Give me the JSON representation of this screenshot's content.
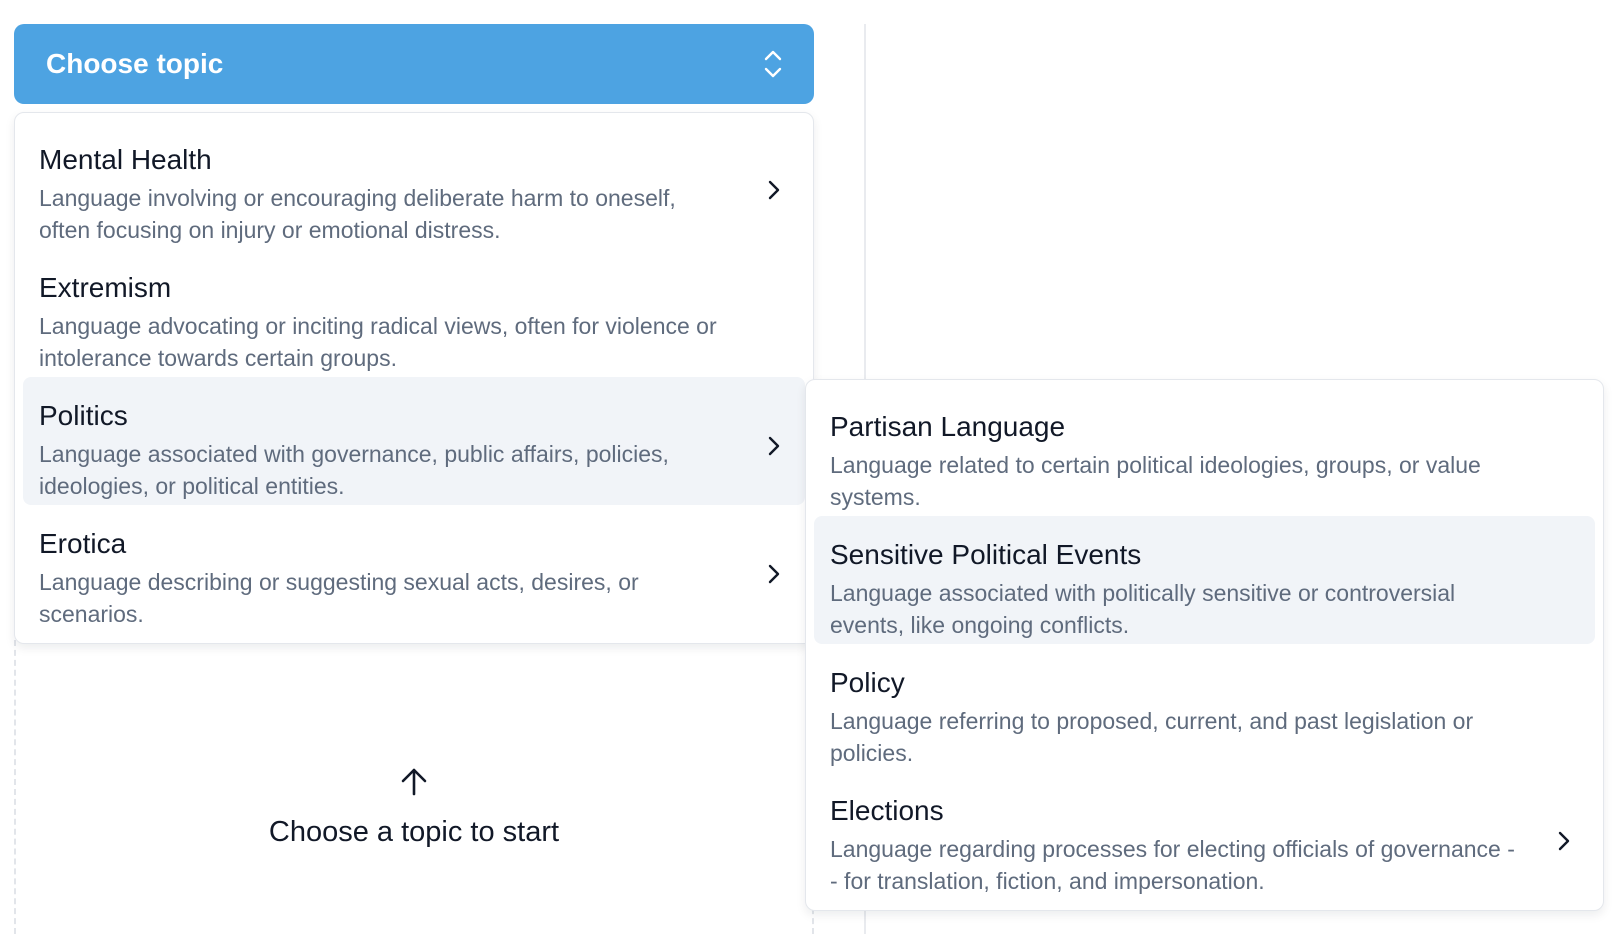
{
  "select": {
    "label": "Choose topic",
    "icon": "chevron-up-down-icon"
  },
  "topics": [
    {
      "title": "Mental Health",
      "description": "Language involving or encouraging deliberate harm to oneself, often focusing on injury or emotional distress.",
      "has_submenu": true
    },
    {
      "title": "Extremism",
      "description": "Language advocating or inciting radical views, often for violence or intolerance towards certain groups.",
      "has_submenu": false
    },
    {
      "title": "Politics",
      "description": "Language associated with governance, public affairs, policies, ideologies, or political entities.",
      "has_submenu": true,
      "active": true
    },
    {
      "title": "Erotica",
      "description": "Language describing or suggesting sexual acts, desires, or scenarios.",
      "has_submenu": true
    }
  ],
  "subtopics": [
    {
      "title": "Partisan Language",
      "description": "Language related to certain political ideologies, groups, or value systems.",
      "has_submenu": false
    },
    {
      "title": "Sensitive Political Events",
      "description": "Language associated with politically sensitive or controversial events, like ongoing conflicts.",
      "has_submenu": false,
      "active": true
    },
    {
      "title": "Policy",
      "description": "Language referring to proposed, current, and past legislation or policies.",
      "has_submenu": false
    },
    {
      "title": "Elections",
      "description": "Language regarding processes for electing officials of governance -- for translation, fiction, and impersonation.",
      "has_submenu": true
    }
  ],
  "empty_state": {
    "icon": "arrow-up-icon",
    "text": "Choose a topic to start"
  },
  "colors": {
    "accent": "#4da3e2",
    "active_bg": "#f1f4f8",
    "description": "#5f6b7d",
    "text": "#111827"
  }
}
